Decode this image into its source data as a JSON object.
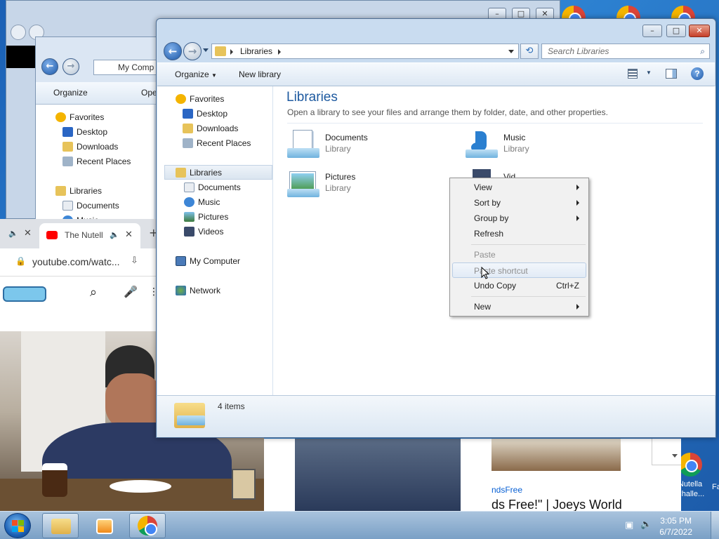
{
  "desktop": {
    "chrome_shortcut_label": "Nutella Challe...",
    "partial_label": "Fa"
  },
  "back_explorer": {
    "address_text": "My Comp",
    "toolbar": {
      "organize": "Organize",
      "open": "Open"
    },
    "nav": [
      "Favorites",
      "Desktop",
      "Downloads",
      "Recent Places",
      "Libraries",
      "Documents",
      "Music"
    ]
  },
  "browser": {
    "tab_title": "The Nutell",
    "url": "youtube.com/watc...",
    "strip_channel": "ndsFree",
    "strip_title": "ds Free!\" | Joeys World"
  },
  "explorer": {
    "breadcrumb": "Libraries",
    "search_placeholder": "Search Libraries",
    "toolbar": {
      "organize": "Organize",
      "new_library": "New library"
    },
    "nav": {
      "favorites": "Favorites",
      "desktop": "Desktop",
      "downloads": "Downloads",
      "recent_places": "Recent Places",
      "libraries": "Libraries",
      "documents": "Documents",
      "music": "Music",
      "pictures": "Pictures",
      "videos": "Videos",
      "my_computer": "My Computer",
      "network": "Network"
    },
    "heading": "Libraries",
    "description": "Open a library to see your files and arrange them by folder, date, and other properties.",
    "libraries": [
      {
        "name": "Documents",
        "type": "Library"
      },
      {
        "name": "Music",
        "type": "Library"
      },
      {
        "name": "Pictures",
        "type": "Library"
      },
      {
        "name": "Vid",
        "type": ""
      }
    ],
    "status": "4 items"
  },
  "context_menu": {
    "items": [
      {
        "label": "View",
        "submenu": true
      },
      {
        "label": "Sort by",
        "submenu": true
      },
      {
        "label": "Group by",
        "submenu": true
      },
      {
        "label": "Refresh"
      },
      {
        "label": "Paste",
        "disabled": true
      },
      {
        "label": "Paste shortcut",
        "disabled": true
      },
      {
        "label": "Undo Copy",
        "shortcut": "Ctrl+Z"
      },
      {
        "label": "New",
        "submenu": true
      }
    ]
  },
  "taskbar": {
    "time": "3:05 PM",
    "date": "6/7/2022"
  },
  "colors": {
    "heading": "#1e5aa0",
    "accent": "#1c58a8",
    "taskbar": "#8fb0d2"
  }
}
